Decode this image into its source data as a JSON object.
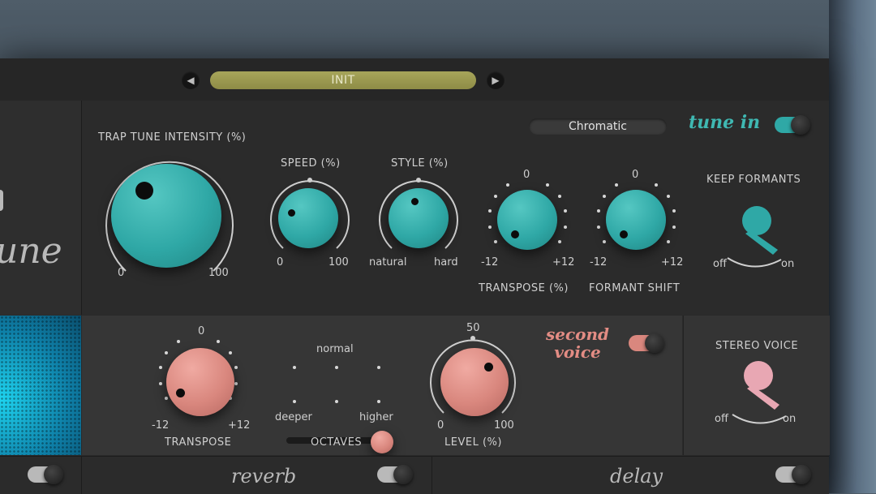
{
  "preset": {
    "name": "INIT",
    "prev_icon": "triangle-left-icon",
    "next_icon": "triangle-right-icon"
  },
  "tune": {
    "scale": "Chromatic",
    "tune_in_label": "tune in",
    "tune_in_on": true,
    "intensity": {
      "label": "TRAP TUNE INTENSITY (%)",
      "min": "0",
      "max": "100"
    },
    "speed": {
      "label": "SPEED (%)",
      "min": "0",
      "max": "100"
    },
    "style": {
      "label": "STYLE (%)",
      "min": "natural",
      "max": "hard"
    },
    "transpose": {
      "label": "TRANSPOSE (%)",
      "top": "0",
      "min": "-12",
      "max": "+12"
    },
    "formant_shift": {
      "label": "FORMANT SHIFT",
      "top": "0",
      "min": "-12",
      "max": "+12"
    },
    "keep_formants": {
      "label": "KEEP FORMANTS",
      "off": "off",
      "on": "on",
      "value": "on"
    }
  },
  "second_voice": {
    "title_line1": "second",
    "title_line2": "voice",
    "enabled": true,
    "transpose": {
      "label": "TRANSPOSE",
      "top": "0",
      "min": "-12",
      "max": "+12"
    },
    "octaves": {
      "label": "OCTAVES",
      "top": "normal",
      "left": "deeper",
      "right": "higher",
      "value": "higher"
    },
    "level": {
      "label": "LEVEL (%)",
      "top": "50",
      "min": "0",
      "max": "100"
    }
  },
  "stereo_voice": {
    "label": "STEREO VOICE",
    "off": "off",
    "on": "on",
    "value": "on"
  },
  "effects": {
    "reverb": "reverb",
    "delay": "delay"
  },
  "colors": {
    "teal": "#2fa8a6",
    "pink": "#d9877e",
    "preset_bar": "#a7a55a",
    "panel": "#2b2b2b"
  }
}
